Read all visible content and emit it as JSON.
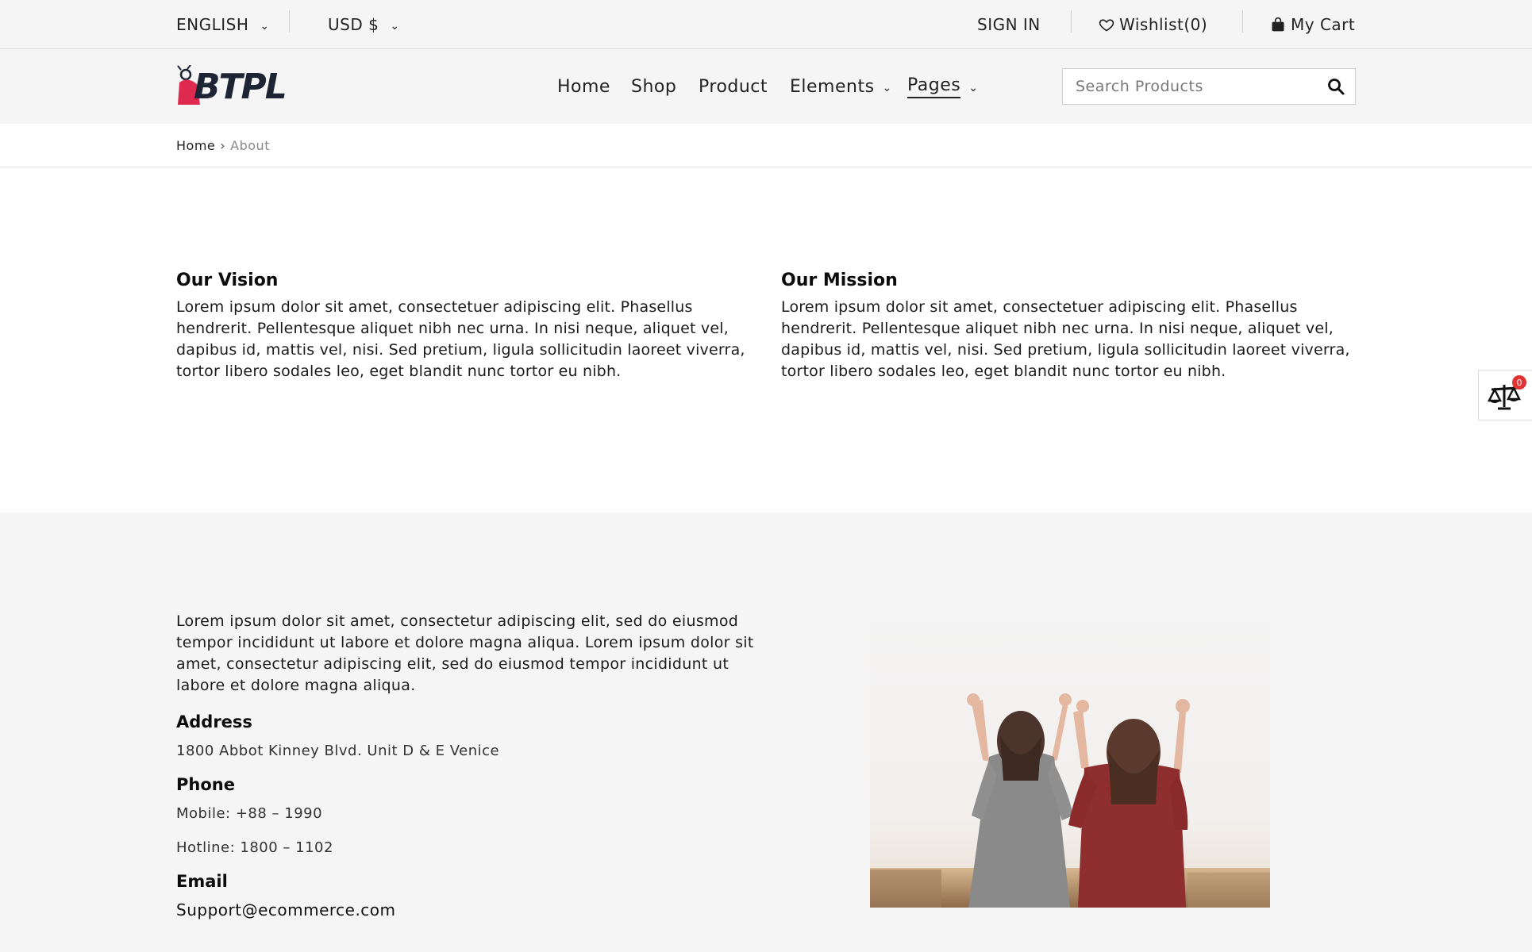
{
  "topbar": {
    "language": "ENGLISH",
    "currency": "USD $",
    "signin": "SIGN IN",
    "wishlist": "Wishlist(0)",
    "cart": "My Cart"
  },
  "brand": {
    "logo_text": "BTPL"
  },
  "nav": {
    "items": [
      {
        "label": "Home"
      },
      {
        "label": "Shop"
      },
      {
        "label": "Product"
      },
      {
        "label": "Elements"
      },
      {
        "label": "Pages"
      }
    ]
  },
  "search": {
    "placeholder": "Search Products"
  },
  "breadcrumb": {
    "home": "Home",
    "current": "About"
  },
  "vision": {
    "title": "Our Vision",
    "text": "Lorem ipsum dolor sit amet, consectetuer adipiscing elit. Phasellus hendrerit. Pellentesque aliquet nibh nec urna. In nisi neque, aliquet vel, dapibus id, mattis vel, nisi. Sed pretium, ligula sollicitudin laoreet viverra, tortor libero sodales leo, eget blandit nunc tortor eu nibh."
  },
  "mission": {
    "title": "Our Mission",
    "text": "Lorem ipsum dolor sit amet, consectetuer adipiscing elit. Phasellus hendrerit. Pellentesque aliquet nibh nec urna. In nisi neque, aliquet vel, dapibus id, mattis vel, nisi. Sed pretium, ligula sollicitudin laoreet viverra, tortor libero sodales leo, eget blandit nunc tortor eu nibh."
  },
  "contact": {
    "intro": "Lorem ipsum dolor sit amet, consectetur adipiscing elit, sed do eiusmod tempor incididunt ut labore et dolore magna aliqua. Lorem ipsum dolor sit amet, consectetur adipiscing elit, sed do eiusmod tempor incididunt ut labore et dolore magna aliqua.",
    "address_title": "Address",
    "address": "1800 Abbot Kinney Blvd. Unit D & E Venice",
    "phone_title": "Phone",
    "mobile": "Mobile: +88 – 1990",
    "hotline": "Hotline: 1800 – 1102",
    "email_title": "Email",
    "email": "Support@ecommerce.com"
  },
  "compare": {
    "count": "0"
  },
  "colors": {
    "page_bg": "#f5f5f5",
    "text": "#111111",
    "accent_logo": "#e0294f",
    "badge": "#e03434"
  },
  "icons": [
    "heart-icon",
    "bag-icon",
    "search-icon",
    "chevron-down-icon",
    "chevron-right-icon",
    "compare-scale-icon"
  ]
}
